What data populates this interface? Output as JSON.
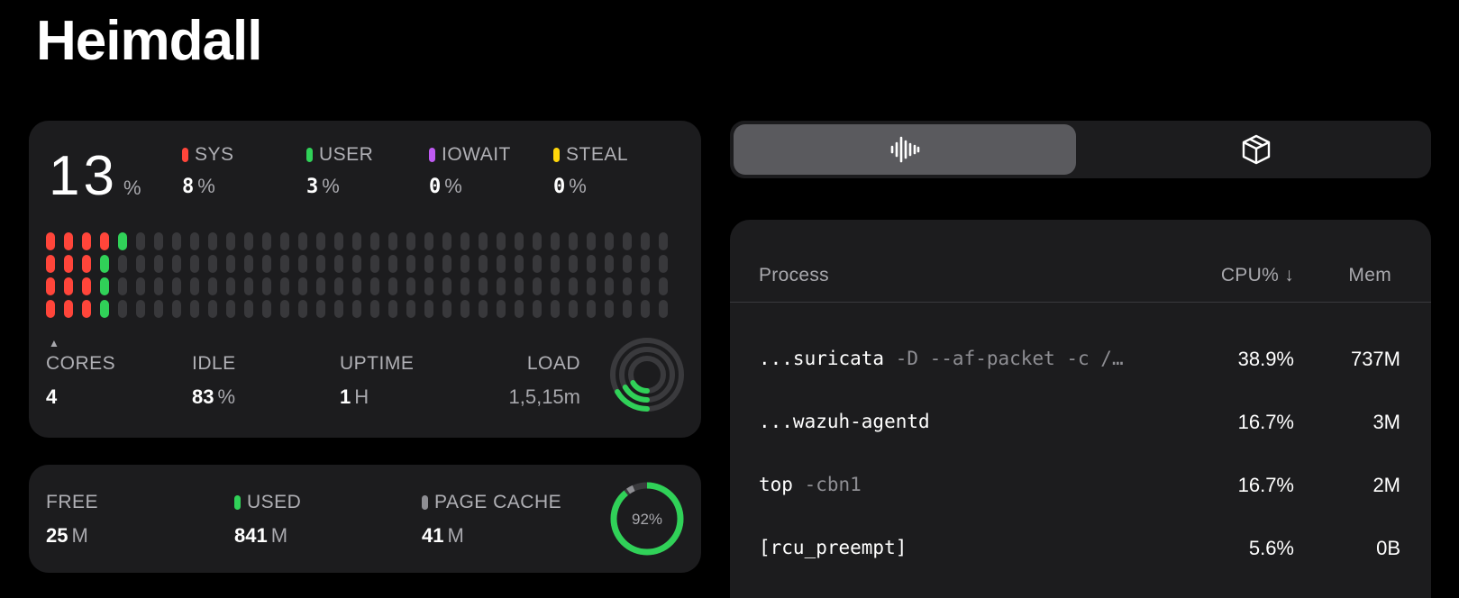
{
  "app": {
    "title": "Heimdall"
  },
  "colors": {
    "sys": "#ff453a",
    "user": "#30d158",
    "iowait": "#bf5af2",
    "steal": "#ffd60a",
    "idle_bar": "#38383b",
    "page_cache": "#8e8e93"
  },
  "cpu": {
    "total": "13",
    "total_unit": "%",
    "legend": [
      {
        "label": "SYS",
        "value": "8",
        "unit": "%",
        "color": "#ff453a"
      },
      {
        "label": "USER",
        "value": "3",
        "unit": "%",
        "color": "#30d158"
      },
      {
        "label": "IOWAIT",
        "value": "0",
        "unit": "%",
        "color": "#bf5af2"
      },
      {
        "label": "STEAL",
        "value": "0",
        "unit": "%",
        "color": "#ffd60a"
      }
    ],
    "core_grid": {
      "rows": [
        {
          "sys": 4,
          "user": 1
        },
        {
          "sys": 3,
          "user": 1
        },
        {
          "sys": 3,
          "user": 1
        },
        {
          "sys": 3,
          "user": 1
        }
      ],
      "bars_per_row": 35
    },
    "arrow_glyph": "▲",
    "stats": {
      "cores": {
        "label": "CORES",
        "value": "4",
        "unit": ""
      },
      "idle": {
        "label": "IDLE",
        "value": "83",
        "unit": "%"
      },
      "uptime": {
        "label": "UPTIME",
        "value": "1",
        "unit": "H"
      },
      "load": {
        "label": "LOAD",
        "value": "1,5,15m"
      }
    }
  },
  "memory": {
    "free": {
      "label": "FREE",
      "value": "25",
      "unit": "M"
    },
    "used": {
      "label": "USED",
      "value": "841",
      "unit": "M",
      "color": "#30d158"
    },
    "page_cache": {
      "label": "PAGE CACHE",
      "value": "41",
      "unit": "M",
      "color": "#8e8e93"
    },
    "ring_percent": "92%",
    "ring_fraction": 0.92
  },
  "segmented": {
    "tabs": [
      {
        "icon": "waveform-icon",
        "active": true
      },
      {
        "icon": "cube-icon",
        "active": false
      }
    ]
  },
  "processes": {
    "headers": {
      "process": "Process",
      "cpu": "CPU% ↓",
      "mem": "Mem"
    },
    "rows": [
      {
        "cmd": "...suricata",
        "args": " -D --af-packet -c /…",
        "cpu": "38.9%",
        "mem": "737M"
      },
      {
        "cmd": "...wazuh-agentd",
        "args": "",
        "cpu": "16.7%",
        "mem": "3M"
      },
      {
        "cmd": "top",
        "args": " -cbn1",
        "cpu": "16.7%",
        "mem": "2M"
      },
      {
        "cmd": "[rcu_preempt]",
        "args": "",
        "cpu": "5.6%",
        "mem": "0B"
      }
    ]
  }
}
